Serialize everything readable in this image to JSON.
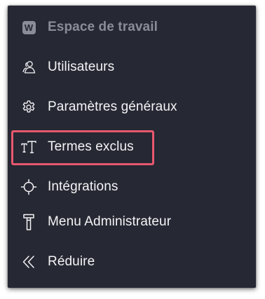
{
  "menu": {
    "header": {
      "label": "Espace de travail",
      "icon": "workspace-badge-icon",
      "badge_letter": "W"
    },
    "items": [
      {
        "label": "Utilisateurs",
        "icon": "users-icon"
      },
      {
        "label": "Paramètres généraux",
        "icon": "gear-icon"
      },
      {
        "label": "Termes exclus",
        "icon": "text-type-icon",
        "highlighted": true
      },
      {
        "label": "Intégrations",
        "icon": "crosshair-icon"
      },
      {
        "label": "Menu Administrateur",
        "icon": "hammer-icon"
      },
      {
        "label": "Réduire",
        "icon": "double-chevron-left-icon"
      }
    ]
  },
  "colors": {
    "panel_background": "#262833",
    "text": "#f4f4f6",
    "header_text": "#8a8d98",
    "highlight_border": "#e8586e"
  }
}
